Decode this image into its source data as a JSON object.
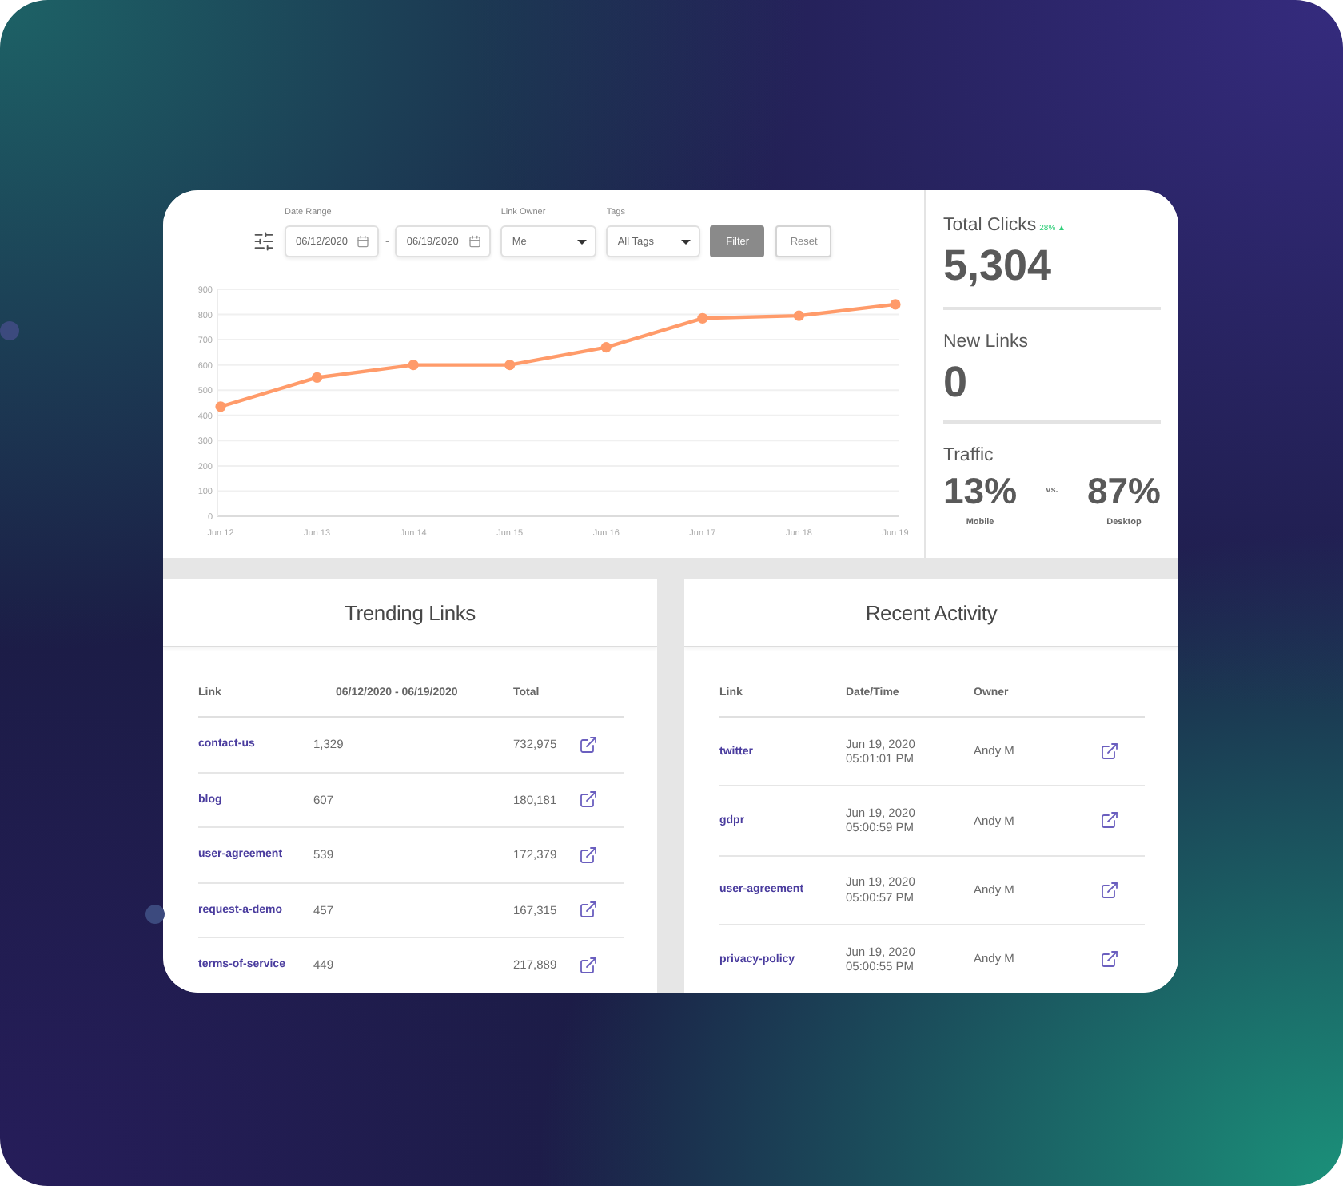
{
  "filters": {
    "date_range": {
      "label": "Date Range",
      "start": "06/12/2020",
      "separator": "-",
      "end": "06/19/2020"
    },
    "link_owner": {
      "label": "Link Owner",
      "value": "Me"
    },
    "tags": {
      "label": "Tags",
      "value": "All Tags"
    },
    "buttons": [
      {
        "label": "Filter",
        "kind": "primary"
      },
      {
        "label": "Reset",
        "kind": "secondary"
      }
    ]
  },
  "chart_data": {
    "type": "line",
    "grid": true,
    "categories": [
      "Jun 12",
      "Jun 13",
      "Jun 14",
      "Jun 15",
      "Jun 16",
      "Jun 17",
      "Jun 18",
      "Jun 19"
    ],
    "series": [
      {
        "color": "#ff9b6a",
        "marker": true,
        "values": [
          435,
          550,
          600,
          600,
          670,
          785,
          795,
          840
        ]
      }
    ],
    "ylim": [
      0,
      900
    ],
    "yticks": [
      0,
      100,
      200,
      300,
      400,
      500,
      600,
      700,
      800,
      900
    ]
  },
  "stats": {
    "total_clicks": {
      "label": "Total Clicks",
      "change": "28% ▲",
      "value": "5,304"
    },
    "new_links": {
      "label": "New Links",
      "value": "0"
    },
    "traffic": {
      "label": "Traffic",
      "mobile": {
        "value": "13%",
        "label": "Mobile"
      },
      "separator": "vs.",
      "desktop": {
        "value": "87%",
        "label": "Desktop"
      }
    }
  },
  "trending_links": {
    "title": "Trending Links",
    "columns": [
      "Link",
      "06/12/2020 - 06/19/2020",
      "Total"
    ],
    "rows": [
      {
        "link": "contact-us",
        "period": "1,329",
        "total": "732,975"
      },
      {
        "link": "blog",
        "period": "607",
        "total": "180,181"
      },
      {
        "link": "user-agreement",
        "period": "539",
        "total": "172,379"
      },
      {
        "link": "request-a-demo",
        "period": "457",
        "total": "167,315"
      },
      {
        "link": "terms-of-service",
        "period": "449",
        "total": "217,889"
      }
    ]
  },
  "recent_activity": {
    "title": "Recent Activity",
    "columns": [
      "Link",
      "Date/Time",
      "Owner"
    ],
    "rows": [
      {
        "link": "twitter",
        "date": "Jun 19, 2020",
        "time": "05:01:01 PM",
        "owner": "Andy M"
      },
      {
        "link": "gdpr",
        "date": "Jun 19, 2020",
        "time": "05:00:59 PM",
        "owner": "Andy M"
      },
      {
        "link": "user-agreement",
        "date": "Jun 19, 2020",
        "time": "05:00:57 PM",
        "owner": "Andy M"
      },
      {
        "link": "privacy-policy",
        "date": "Jun 19, 2020",
        "time": "05:00:55 PM",
        "owner": "Andy M"
      }
    ]
  }
}
